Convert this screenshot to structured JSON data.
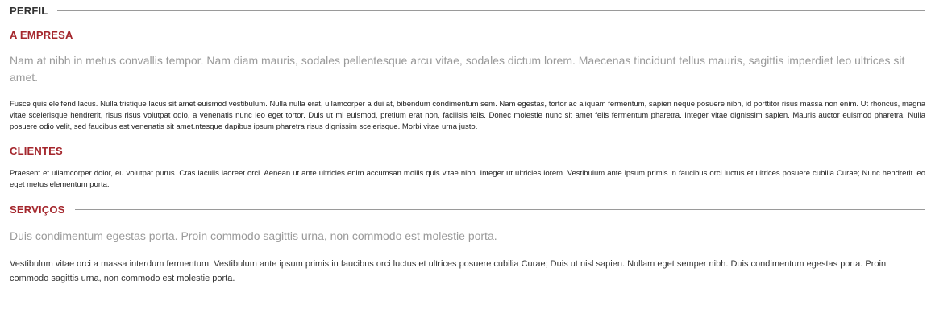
{
  "perfil": {
    "title": "PERFIL"
  },
  "empresa": {
    "title": "A EMPRESA",
    "lead": "Nam at nibh in metus convallis tempor. Nam diam mauris, sodales pellentesque arcu vitae, sodales dictum lorem. Maecenas tincidunt tellus mauris, sagittis imperdiet leo ultrices sit amet.",
    "body": "Fusce quis eleifend lacus. Nulla tristique lacus sit amet euismod vestibulum. Nulla nulla erat, ullamcorper a dui at, bibendum condimentum sem. Nam egestas, tortor ac aliquam fermentum, sapien neque posuere nibh, id porttitor risus massa non enim. Ut rhoncus, magna vitae scelerisque hendrerit, risus risus volutpat odio, a venenatis nunc leo eget tortor. Duis ut mi euismod, pretium erat non, facilisis felis. Donec molestie nunc sit amet felis fermentum pharetra. Integer vitae dignissim sapien. Mauris auctor euismod pharetra. Nulla posuere odio velit, sed faucibus est venenatis sit amet.ntesque dapibus ipsum pharetra risus dignissim scelerisque. Morbi vitae urna justo."
  },
  "clientes": {
    "title": "CLIENTES",
    "body": "Praesent et ullamcorper dolor, eu volutpat purus. Cras iaculis laoreet orci. Aenean ut ante ultricies enim accumsan mollis quis vitae nibh. Integer ut ultricies lorem. Vestibulum ante ipsum primis in faucibus orci luctus et ultrices posuere cubilia Curae; Nunc hendrerit leo eget metus elementum porta."
  },
  "servicos": {
    "title": "SERVIÇOS",
    "lead": "Duis condimentum egestas porta. Proin commodo sagittis urna, non commodo est molestie porta.",
    "body": "Vestibulum vitae orci a massa interdum fermentum. Vestibulum ante ipsum primis in faucibus orci luctus et ultrices posuere cubilia Curae; Duis ut nisl sapien. Nullam eget semper nibh. Duis condimentum egestas porta. Proin commodo sagittis urna, non commodo est molestie porta."
  },
  "colors": {
    "heading_dark": "#333333",
    "heading_accent": "#a4262c",
    "lead_text": "#9a9a9a",
    "rule": "#9a9a9a"
  }
}
